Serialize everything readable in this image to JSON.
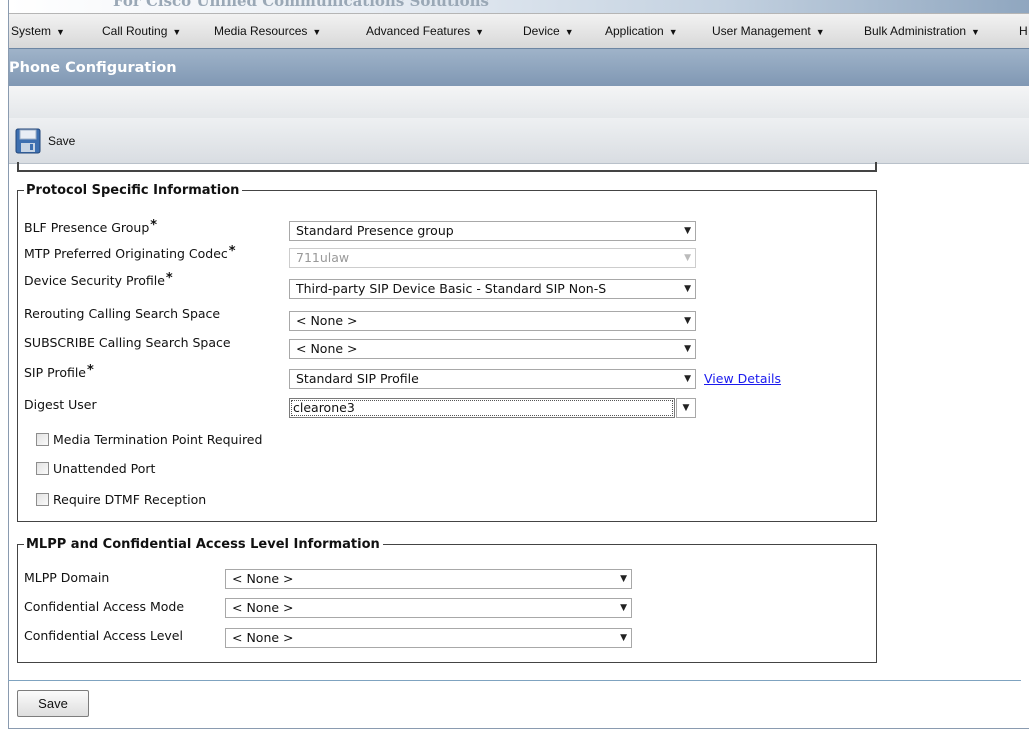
{
  "banner": {
    "text": "For Cisco Unified Communications Solutions"
  },
  "menu": [
    {
      "label": "System"
    },
    {
      "label": "Call Routing"
    },
    {
      "label": "Media Resources"
    },
    {
      "label": "Advanced Features"
    },
    {
      "label": "Device"
    },
    {
      "label": "Application"
    },
    {
      "label": "User Management"
    },
    {
      "label": "Bulk Administration"
    },
    {
      "label": "H"
    }
  ],
  "page": {
    "title": "Phone Configuration"
  },
  "toolbar": {
    "save_label": "Save",
    "save_icon": "floppy-disk-icon"
  },
  "protocol": {
    "legend": "Protocol Specific Information",
    "rows": {
      "blf": {
        "label": "BLF Presence Group",
        "value": "Standard Presence group",
        "required": "*"
      },
      "mtp_codec": {
        "label": "MTP Preferred Originating Codec",
        "value": "711ulaw",
        "required": "*"
      },
      "security": {
        "label": "Device Security Profile",
        "value": "Third-party SIP Device Basic - Standard SIP Non-S",
        "required": "*"
      },
      "rerouting": {
        "label": "Rerouting Calling Search Space",
        "value": "< None >"
      },
      "subscribe": {
        "label": "SUBSCRIBE Calling Search Space",
        "value": "< None >"
      },
      "sip": {
        "label": "SIP Profile",
        "value": "Standard SIP Profile",
        "required": "*",
        "link": "View Details"
      },
      "digest": {
        "label": "Digest User",
        "value": "clearone3"
      }
    },
    "checkboxes": {
      "mtp": "Media Termination Point Required",
      "unattended": "Unattended Port",
      "dtmf": "Require DTMF Reception"
    }
  },
  "mlpp": {
    "legend": "MLPP and Confidential Access Level Information",
    "rows": {
      "domain": {
        "label": "MLPP Domain",
        "value": "< None >"
      },
      "mode": {
        "label": "Confidential Access Mode",
        "value": "< None >"
      },
      "level": {
        "label": "Confidential Access Level",
        "value": "< None >"
      }
    }
  },
  "footer": {
    "save_label": "Save"
  },
  "colors": {
    "title_bar": "#8aa0bb",
    "link": "#1a1aee",
    "menu_bg": "#e2e2e2"
  }
}
